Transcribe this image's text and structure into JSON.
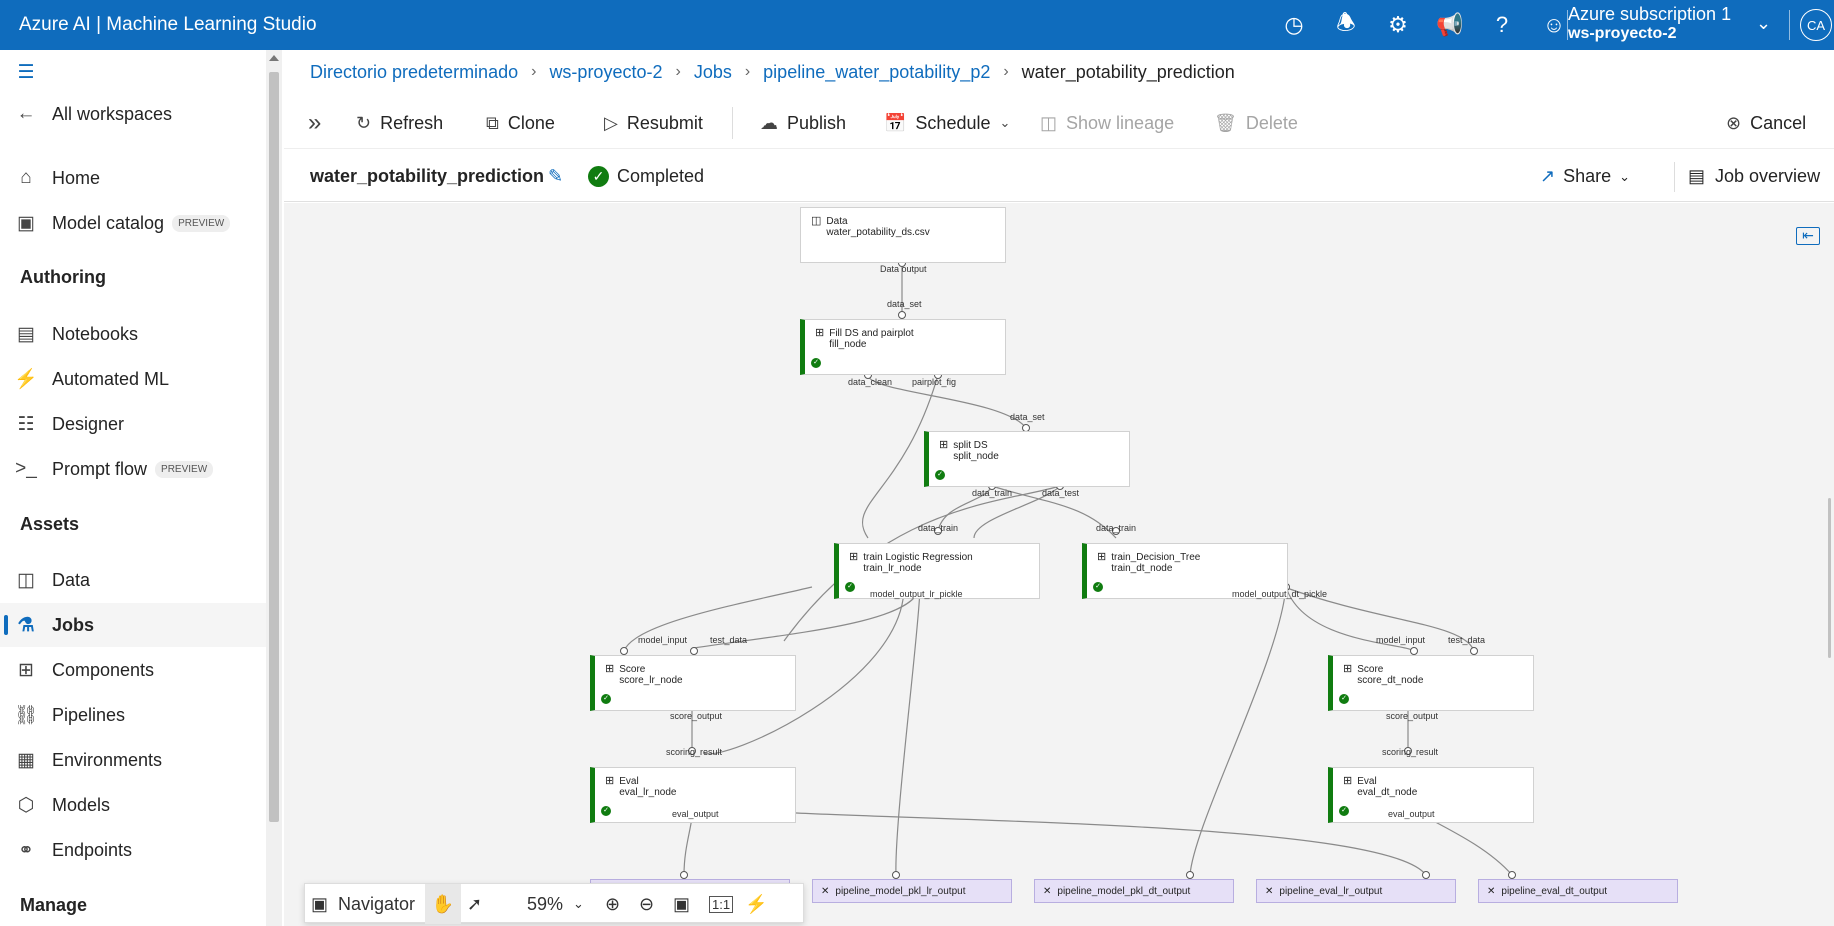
{
  "app": {
    "title": "Azure AI | Machine Learning Studio",
    "subscription": "Azure subscription 1",
    "workspace": "ws-proyecto-2",
    "avatar": "CA"
  },
  "topbar_icons": [
    "history-icon",
    "bell-icon",
    "gear-icon",
    "megaphone-icon",
    "help-icon",
    "smiley-icon"
  ],
  "sidebar": {
    "all_workspaces": "All workspaces",
    "home": "Home",
    "model_catalog": "Model catalog",
    "preview_badge": "PREVIEW",
    "authoring": "Authoring",
    "notebooks": "Notebooks",
    "automated_ml": "Automated ML",
    "designer": "Designer",
    "prompt_flow": "Prompt flow",
    "assets": "Assets",
    "data": "Data",
    "jobs": "Jobs",
    "components": "Components",
    "pipelines": "Pipelines",
    "environments": "Environments",
    "models": "Models",
    "endpoints": "Endpoints",
    "manage": "Manage"
  },
  "breadcrumb": [
    "Directorio predeterminado",
    "ws-proyecto-2",
    "Jobs",
    "pipeline_water_potability_p2",
    "water_potability_prediction"
  ],
  "toolbar": {
    "refresh": "Refresh",
    "clone": "Clone",
    "resubmit": "Resubmit",
    "publish": "Publish",
    "schedule": "Schedule",
    "show_lineage": "Show lineage",
    "delete": "Delete",
    "cancel": "Cancel"
  },
  "job": {
    "name": "water_potability_prediction",
    "status": "Completed",
    "share": "Share",
    "overview": "Job overview"
  },
  "nodes": {
    "data": {
      "title": "Data",
      "sub": "water_potability_ds.csv"
    },
    "fill": {
      "title": "Fill DS and pairplot",
      "sub": "fill_node"
    },
    "split": {
      "title": "split DS",
      "sub": "split_node"
    },
    "train_lr": {
      "title": "train Logistic Regression",
      "sub": "train_lr_node"
    },
    "train_dt": {
      "title": "train_Decision_Tree",
      "sub": "train_dt_node"
    },
    "score_lr": {
      "title": "Score",
      "sub": "score_lr_node"
    },
    "score_dt": {
      "title": "Score",
      "sub": "score_dt_node"
    },
    "eval_lr": {
      "title": "Eval",
      "sub": "eval_lr_node"
    },
    "eval_dt": {
      "title": "Eval",
      "sub": "eval_dt_node"
    }
  },
  "ports": {
    "data_output": "Data output",
    "data_set": "data_set",
    "data_clean": "data_clean",
    "pairplot_fig": "pairplot_fig",
    "data_set2": "data_set",
    "data_train": "data_train",
    "data_test": "data_test",
    "data_train_lr": "data_train",
    "data_train_dt": "data_train",
    "model_output_lr": "model_output_lr_pickle",
    "model_output_dt": "model_output_dt_pickle",
    "model_input_lr": "model_input",
    "test_data_lr": "test_data",
    "model_input_dt": "model_input",
    "test_data_dt": "test_data",
    "score_output_lr": "score_output",
    "score_output_dt": "score_output",
    "scoring_result_lr": "scoring_result",
    "scoring_result_dt": "scoring_result",
    "eval_output_lr": "eval_output",
    "eval_output_dt": "eval_output"
  },
  "outputs": [
    "pipeline_model_pkl_lr_output",
    "pipeline_model_pkl_dt_output",
    "pipeline_eval_lr_output",
    "pipeline_eval_dt_output"
  ],
  "navigator": {
    "label": "Navigator",
    "zoom": "59%",
    "actual_size": "1:1"
  }
}
